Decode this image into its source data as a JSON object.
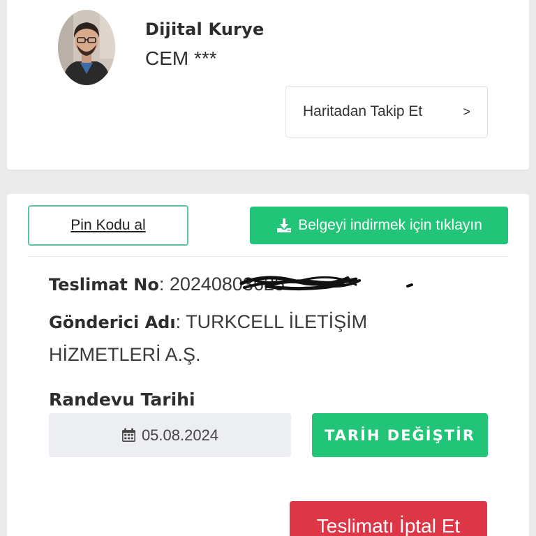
{
  "courier": {
    "label": "Dijital Kurye",
    "name": "CEM ***",
    "track_button": "Haritadan Takip Et",
    "track_chevron": ">"
  },
  "actions": {
    "pin_button": "Pin Kodu al",
    "download_button": "Belgeyi indirmek için tıklayın"
  },
  "delivery": {
    "no_label": "Teslimat No",
    "no_value": ": 20240803625",
    "sender_label": "Gönderici Adı",
    "sender_value": ": TURKCELL İLETİŞİM HİZMETLERİ A.Ş."
  },
  "appointment": {
    "label": "Randevu Tarihi",
    "date": "05.08.2024",
    "change_button": "TARİH DEĞİŞTİR"
  },
  "cancel_button": "Teslimatı İptal Et",
  "colors": {
    "primary_green": "#22c577",
    "danger_red": "#dd3747",
    "outline_green": "#5cc59b"
  }
}
